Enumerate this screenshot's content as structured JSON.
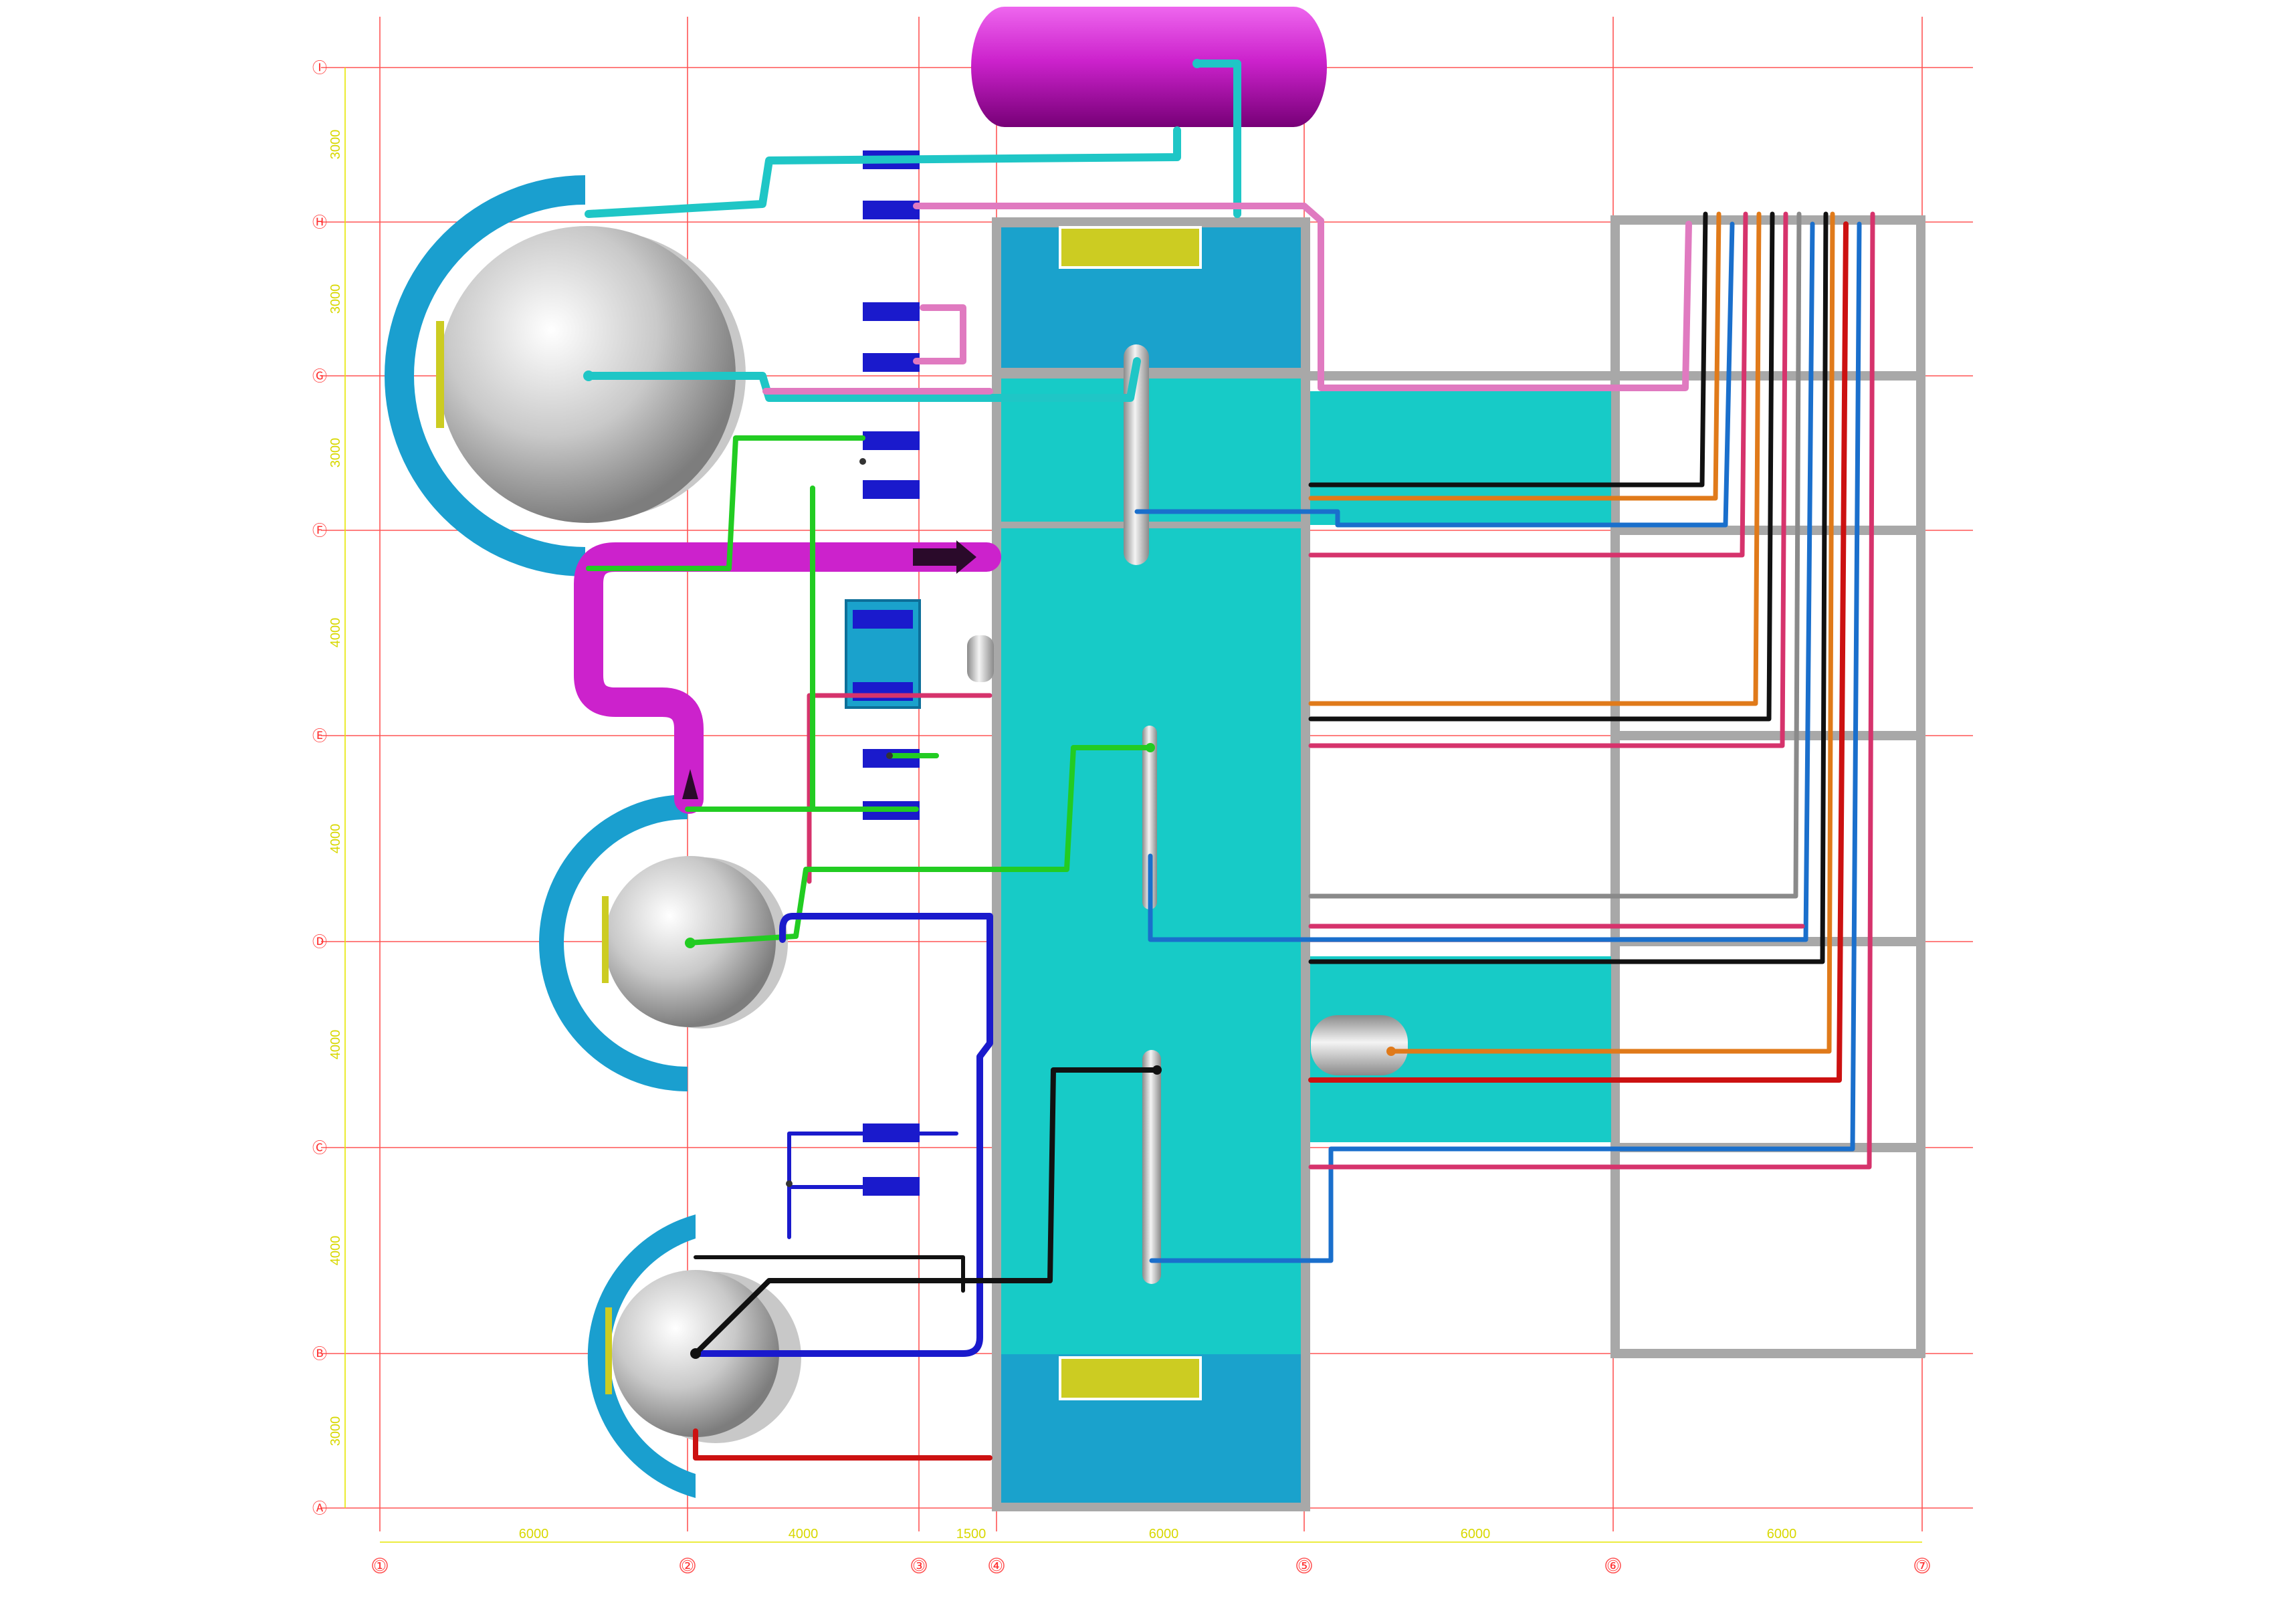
{
  "grid": {
    "columns": [
      "①",
      "②",
      "③",
      "④",
      "⑤",
      "⑥",
      "⑦"
    ],
    "rows": [
      "Ⓘ",
      "Ⓗ",
      "Ⓖ",
      "Ⓕ",
      "Ⓔ",
      "Ⓓ",
      "Ⓒ",
      "Ⓑ",
      "Ⓐ"
    ],
    "column_spacings": [
      "6000",
      "4000",
      "1500",
      "6000",
      "6000",
      "6000"
    ],
    "row_spacings": [
      "3000",
      "3000",
      "3000",
      "4000",
      "4000",
      "4000",
      "4000",
      "3000"
    ]
  },
  "colors": {
    "grid": "#ff5555",
    "dimension": "#e6e600",
    "building_floor": "#17cbc7",
    "building_bay": "#1aa2cc",
    "sphere_shroud": "#1a9fcf",
    "tank": "#cc22cc",
    "rack": "#a8a8a8",
    "pipe_cyan": "#1fc6c6",
    "pipe_green": "#22cc22",
    "pipe_blue": "#1a1acc",
    "pipe_pink": "#d6336c",
    "pipe_orange": "#e07a1a",
    "pipe_black": "#111111",
    "pipe_red": "#cc1111"
  },
  "icons": [
    "flow-arrow-icon",
    "valve-icon"
  ]
}
